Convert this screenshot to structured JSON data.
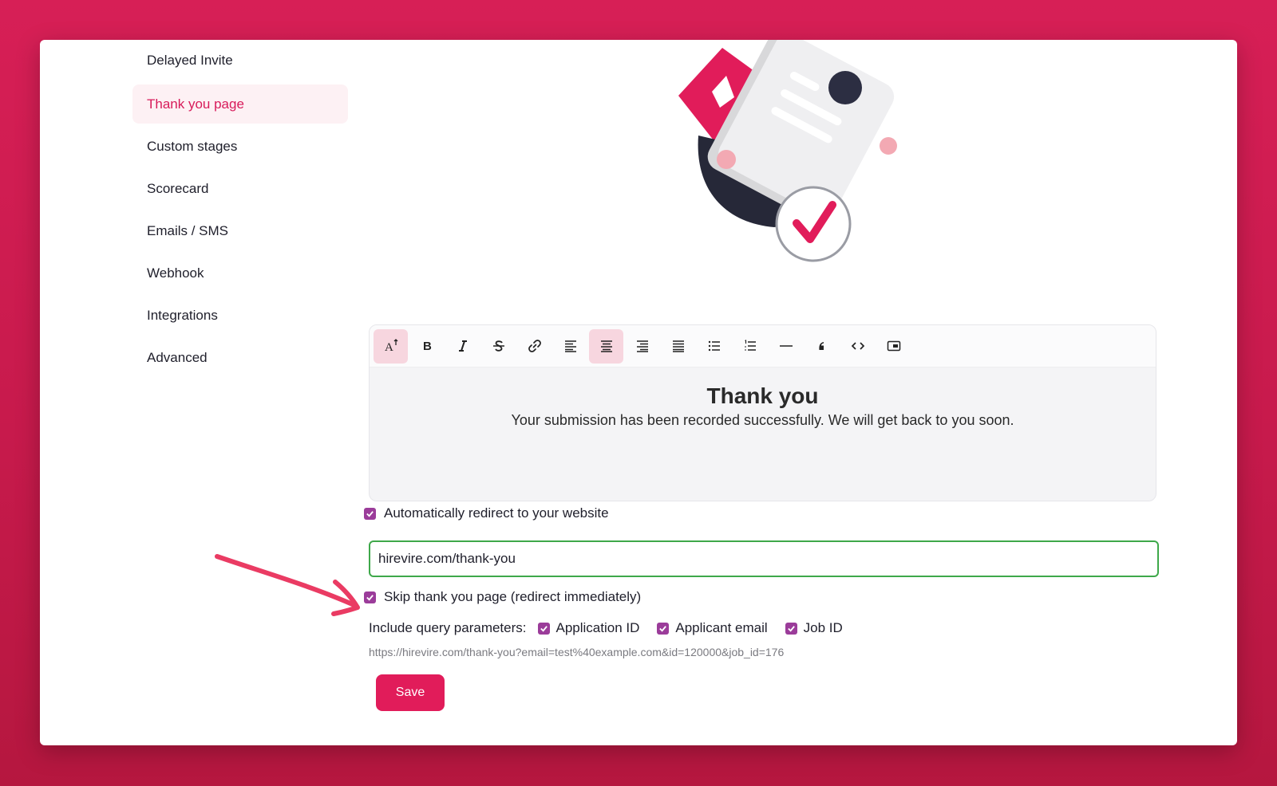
{
  "sidebar": {
    "items": [
      {
        "label": "Delayed Invite"
      },
      {
        "label": "Thank you page",
        "active": true
      },
      {
        "label": "Custom stages"
      },
      {
        "label": "Scorecard"
      },
      {
        "label": "Emails / SMS"
      },
      {
        "label": "Webhook"
      },
      {
        "label": "Integrations"
      },
      {
        "label": "Advanced"
      }
    ]
  },
  "toolbar": {
    "buttons": [
      {
        "icon": "font-size-icon",
        "active": true
      },
      {
        "icon": "bold-icon"
      },
      {
        "icon": "italic-icon"
      },
      {
        "icon": "strikethrough-icon"
      },
      {
        "icon": "link-icon"
      },
      {
        "icon": "align-left-icon"
      },
      {
        "icon": "align-center-icon",
        "active": true
      },
      {
        "icon": "align-right-icon"
      },
      {
        "icon": "align-justify-icon"
      },
      {
        "icon": "bullet-list-icon"
      },
      {
        "icon": "numbered-list-icon"
      },
      {
        "icon": "horizontal-rule-icon"
      },
      {
        "icon": "blockquote-icon"
      },
      {
        "icon": "code-icon"
      },
      {
        "icon": "embed-icon"
      }
    ]
  },
  "editor": {
    "title": "Thank you",
    "body": "Your submission has been recorded successfully. We will get back to you soon."
  },
  "redirect": {
    "label": "Automatically redirect to your website",
    "checked": true,
    "url": "hirevire.com/thank-you"
  },
  "skip": {
    "label": "Skip thank you page (redirect immediately)",
    "checked": true
  },
  "query": {
    "label": "Include query parameters:",
    "params": [
      {
        "label": "Application ID",
        "checked": true
      },
      {
        "label": "Applicant email",
        "checked": true
      },
      {
        "label": "Job ID",
        "checked": true
      }
    ],
    "preview": "https://hirevire.com/thank-you?email=test%40example.com&id=120000&job_id=176"
  },
  "save_label": "Save",
  "colors": {
    "brand": "#e11c5a",
    "checkbox": "#9b3c9a",
    "input_border": "#3ea84a",
    "background": "#d71f56"
  }
}
